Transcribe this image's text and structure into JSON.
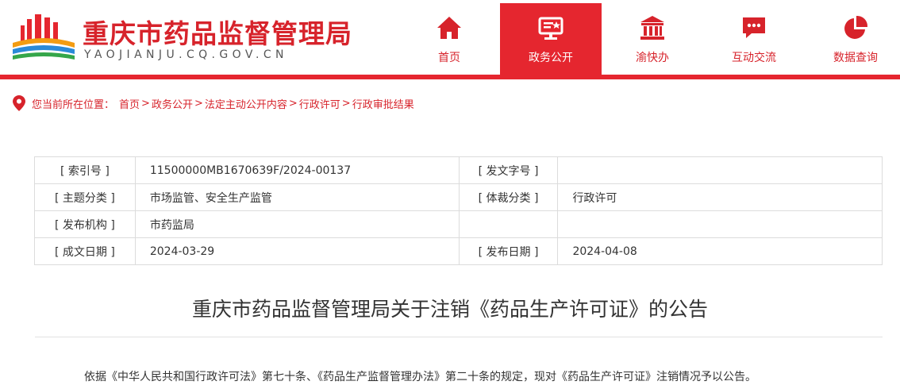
{
  "header": {
    "site_title": "重庆市药品监督管理局",
    "site_domain": "YAOJIANJU.CQ.GOV.CN"
  },
  "nav": [
    {
      "label": "首页",
      "icon": "home-icon"
    },
    {
      "label": "政务公开",
      "icon": "monitor-icon"
    },
    {
      "label": "渝快办",
      "icon": "government-building-icon"
    },
    {
      "label": "互动交流",
      "icon": "chat-icon"
    },
    {
      "label": "数据查询",
      "icon": "pie-chart-icon"
    }
  ],
  "colors": {
    "brand_red": "#e5262f",
    "text": "#333333"
  },
  "breadcrumb": {
    "prefix": "您当前所在位置：",
    "items": [
      "首页",
      "政务公开",
      "法定主动公开内容",
      "行政许可",
      "行政审批结果"
    ],
    "separator": ">"
  },
  "info": {
    "index_label": "[ 索引号 ]",
    "index_value": "11500000MB1670639F/2024-00137",
    "docnum_label": "[ 发文字号 ]",
    "docnum_value": "",
    "topic_label": "[ 主题分类 ]",
    "topic_value": "市场监管、安全生产监管",
    "genre_label": "[ 体裁分类 ]",
    "genre_value": "行政许可",
    "publisher_label": "[ 发布机构 ]",
    "publisher_value": "市药监局",
    "created_label": "[ 成文日期 ]",
    "created_value": "2024-03-29",
    "published_label": "[ 发布日期 ]",
    "published_value": "2024-04-08"
  },
  "article": {
    "title": "重庆市药品监督管理局关于注销《药品生产许可证》的公告",
    "body": "依据《中华人民共和国行政许可法》第七十条、《药品生产监督管理办法》第二十条的规定，现对《药品生产许可证》注销情况予以公告。"
  }
}
